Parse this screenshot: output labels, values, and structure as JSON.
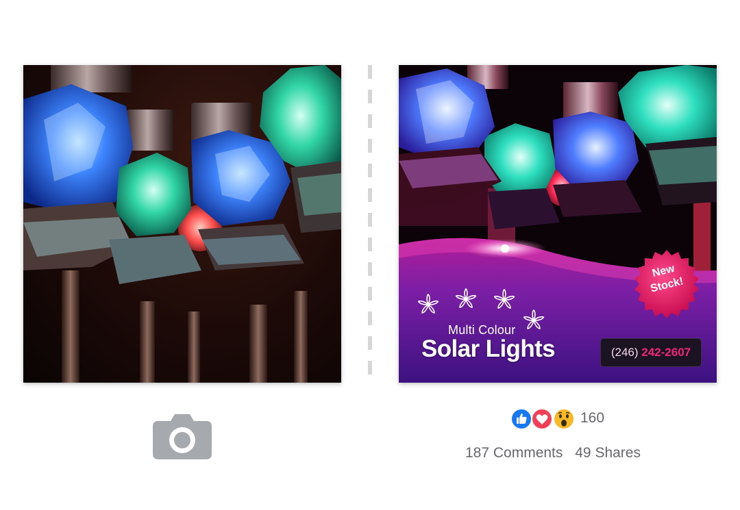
{
  "promo": {
    "subtitle": "Multi Colour",
    "title": "Solar Lights",
    "badge_line1": "New",
    "badge_line2": "Stock!",
    "phone_area": "(246)",
    "phone_number": "242-2607"
  },
  "reactions": {
    "icons": [
      "like-icon",
      "love-icon",
      "wow-icon"
    ],
    "count": "160"
  },
  "engagement": {
    "comments": "187 Comments",
    "shares": "49 Shares"
  },
  "icons": {
    "upload": "camera-icon",
    "flowers": "flower-icon"
  },
  "colors": {
    "accent_pink": "#e8125f",
    "banner_purple": "#7a1fa3",
    "like_blue": "#1877f2",
    "love_red": "#f33e58",
    "wow_yellow": "#f7b928",
    "meta_text": "#65676b"
  }
}
